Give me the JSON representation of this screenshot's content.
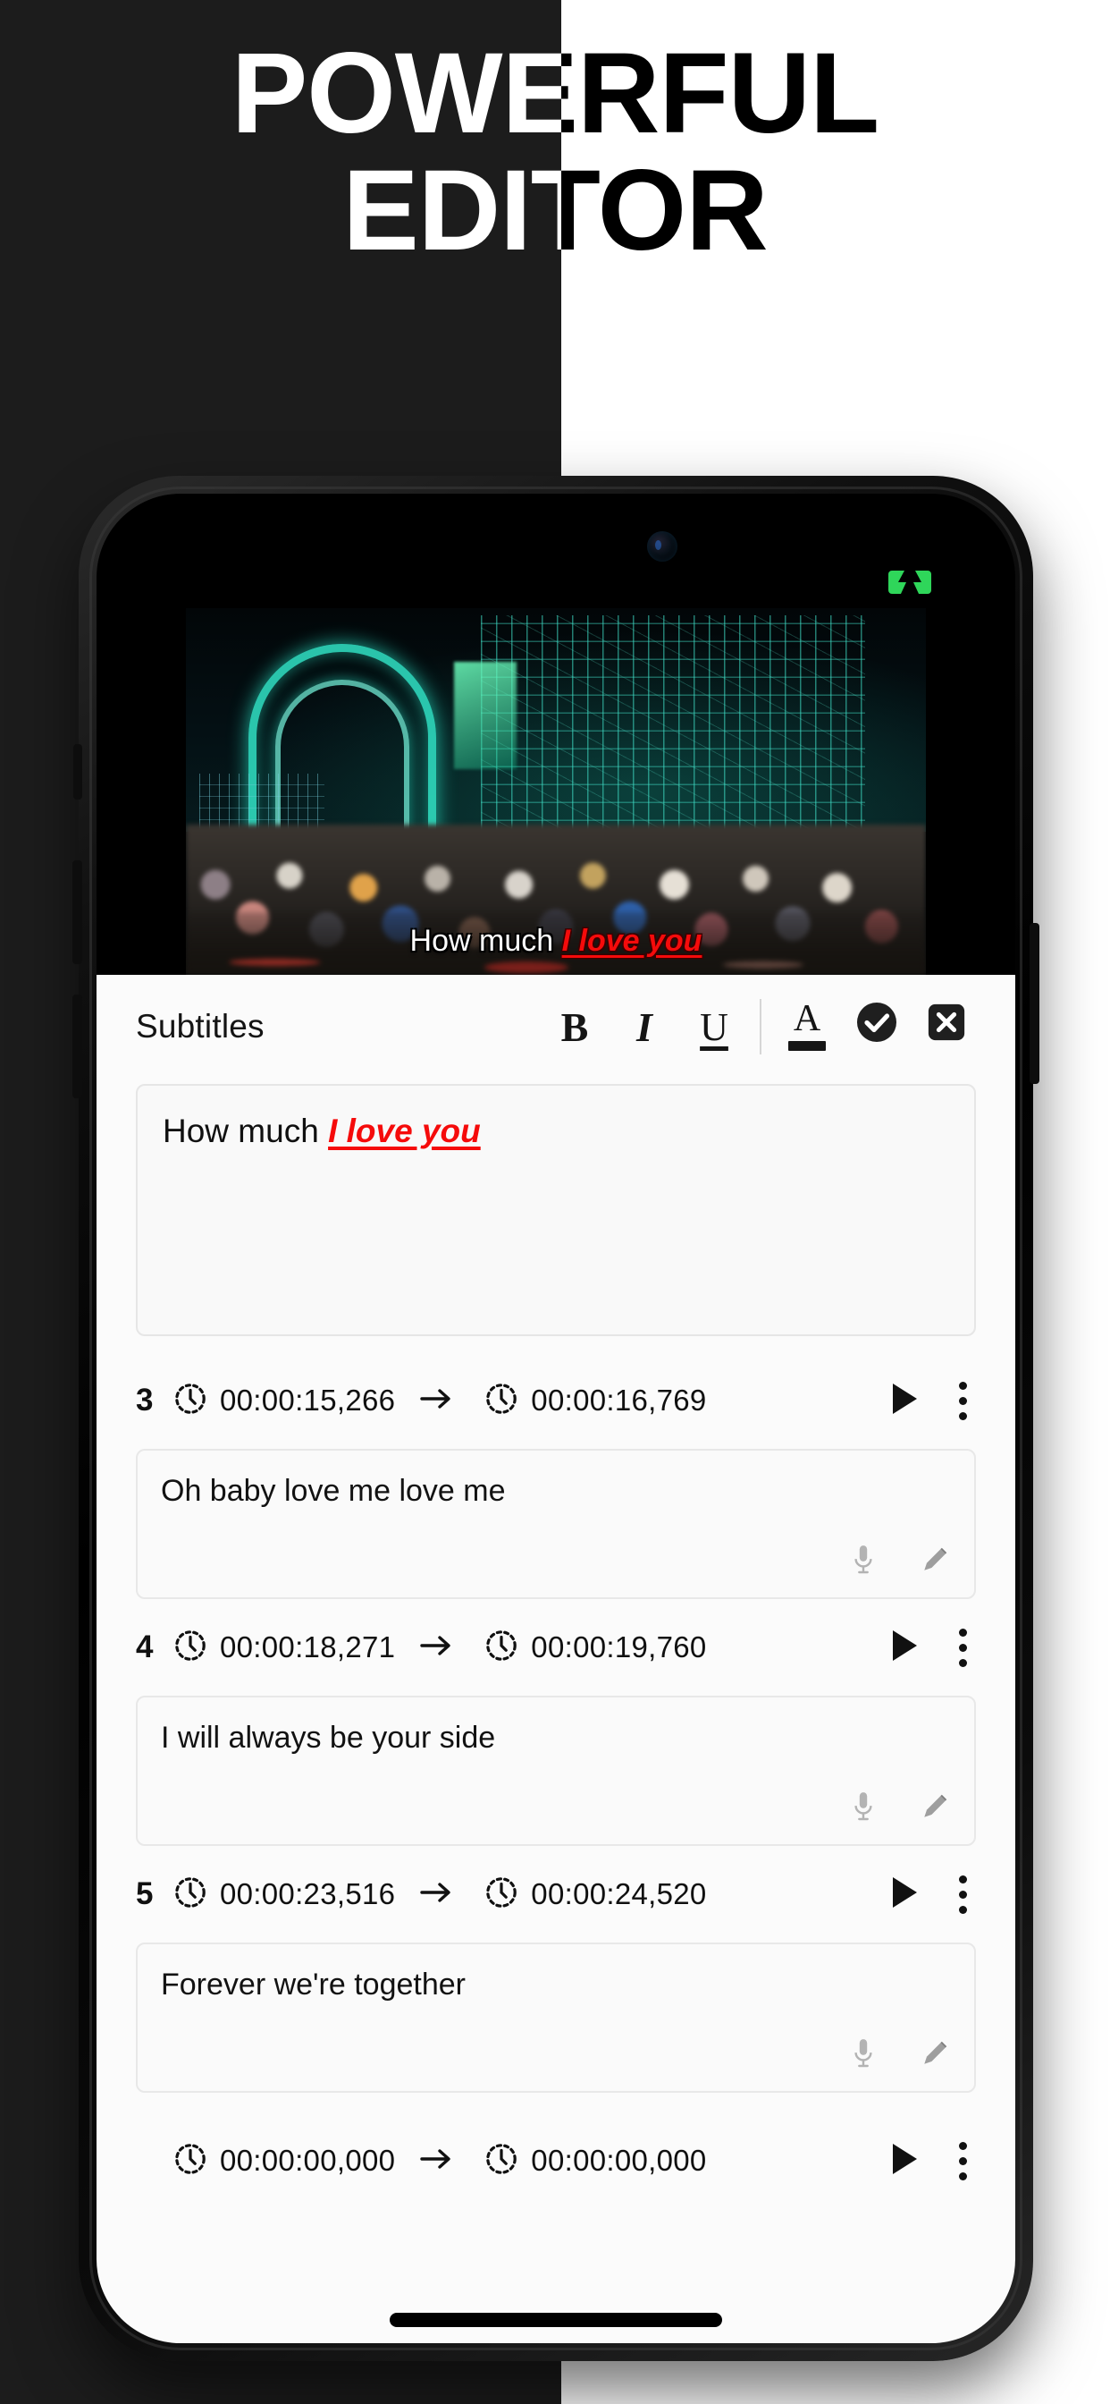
{
  "promo": {
    "heading_line1": "POWERFUL",
    "heading_line2": "EDITOR",
    "bg_dark": "#1c1c1c",
    "bg_light": "#ffffff"
  },
  "phone": {
    "status": {
      "battery_icon": "battery-charging-icon",
      "battery_color": "#2fd65a"
    }
  },
  "video": {
    "subtitle_plain": "How much ",
    "subtitle_styled": "I love you",
    "styled_color": "#f50b0b"
  },
  "editor": {
    "title": "Subtitles",
    "buttons": {
      "bold": "B",
      "italic": "I",
      "underline": "U",
      "text_color": "A",
      "confirm": "confirm-check-icon",
      "close": "close-x-icon"
    },
    "content_plain": "How much ",
    "content_styled": "I love you"
  },
  "list": {
    "rows": [
      {
        "index": "3",
        "start": "00:00:15,266",
        "end": "00:00:16,769",
        "text": "Oh baby love me love me"
      },
      {
        "index": "4",
        "start": "00:00:18,271",
        "end": "00:00:19,760",
        "text": "I will always be your side"
      },
      {
        "index": "5",
        "start": "00:00:23,516",
        "end": "00:00:24,520",
        "text": "Forever we're together"
      }
    ],
    "cut_row": {
      "start": "00:00:00,000",
      "end": "00:00:00,000"
    },
    "icons": {
      "clock": "clock-icon",
      "arrow": "arrow-right-icon",
      "play": "play-icon",
      "menu": "more-vertical-icon",
      "mic": "microphone-icon",
      "edit": "pencil-icon"
    }
  }
}
